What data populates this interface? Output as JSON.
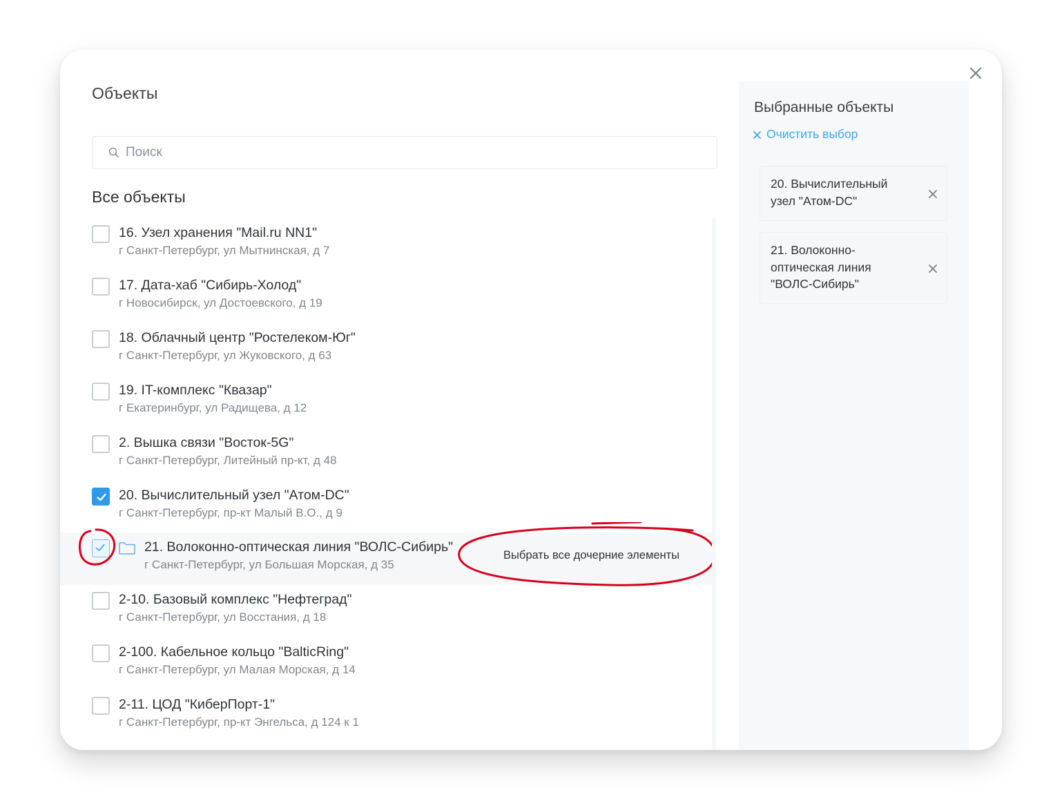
{
  "dialog": {
    "title": "Объекты",
    "close_icon": "close-icon"
  },
  "search": {
    "placeholder": "Поиск",
    "value": "",
    "icon": "search-icon"
  },
  "list": {
    "title": "Все объекты",
    "items": [
      {
        "name": "16. Узел хранения \"Mail.ru NN1\"",
        "address": "г Санкт-Петербург, ул Мытнинская, д 7",
        "state": "unchecked"
      },
      {
        "name": "17. Дата-хаб \"Сибирь-Холод\"",
        "address": "г Новосибирск, ул Достоевского, д 19",
        "state": "unchecked"
      },
      {
        "name": "18. Облачный центр \"Ростелеком-Юг\"",
        "address": "г Санкт-Петербург, ул Жуковского, д 63",
        "state": "unchecked"
      },
      {
        "name": "19. IT-комплекс \"Квазар\"",
        "address": "г Екатеринбург, ул Радищева, д 12",
        "state": "unchecked"
      },
      {
        "name": "2. Вышка связи \"Восток-5G\"",
        "address": "г Санкт-Петербург, Литейный пр-кт, д 48",
        "state": "unchecked"
      },
      {
        "name": "20. Вычислительный узел \"Атом-DC\"",
        "address": "г Санкт-Петербург, пр-кт Малый В.О., д 9",
        "state": "checked"
      },
      {
        "name": "21. Волоконно-оптическая линия \"ВОЛС-Сибирь\"",
        "address": "г Санкт-Петербург, ул Большая Морская, д 35",
        "state": "partial",
        "has_children": true,
        "icon": "folder-icon",
        "tooltip": "Выбрать все дочерние элементы"
      },
      {
        "name": "2-10. Базовый комплекс \"Нефтеград\"",
        "address": "г Санкт-Петербург, ул Восстания, д 18",
        "state": "unchecked"
      },
      {
        "name": "2-100. Кабельное кольцо \"BalticRing\"",
        "address": "г Санкт-Петербург, ул Малая Морская, д 14",
        "state": "unchecked"
      },
      {
        "name": "2-11. ЦОД \"КиберПорт-1\"",
        "address": "г Санкт-Петербург, пр-кт Энгельса, д 124 к 1",
        "state": "unchecked"
      }
    ]
  },
  "selected": {
    "title": "Выбранные объекты",
    "clear_label": "Очистить выбор",
    "items": [
      {
        "label": "20. Вычислительный узел \"Атом-DC\""
      },
      {
        "label": "21. Волоконно-оптическая линия \"ВОЛС-Сибирь\""
      }
    ]
  },
  "colors": {
    "accent": "#2f9be6",
    "link": "#3ea6ea",
    "annotation": "#d8001c",
    "panel_bg": "#f7f8f9"
  }
}
